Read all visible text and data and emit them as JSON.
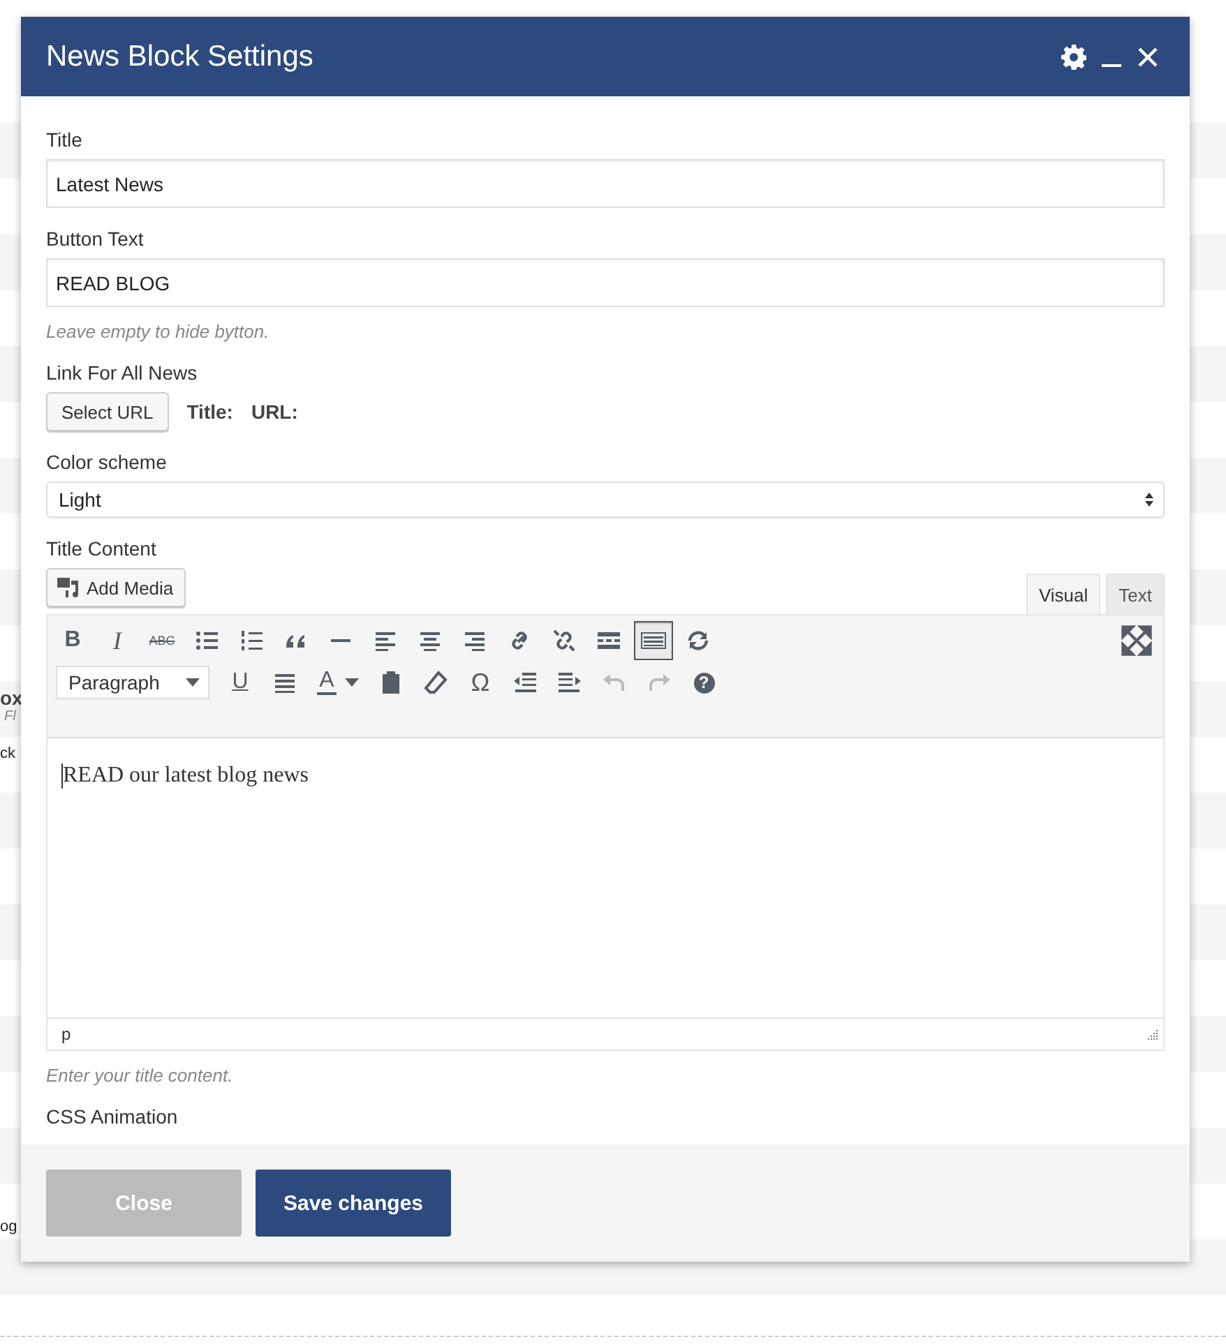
{
  "background_fragments": [
    {
      "text": "ox",
      "kind": "bold"
    },
    {
      "text": "Fl",
      "kind": "italic"
    },
    {
      "text": "ck",
      "kind": "plain"
    },
    {
      "text": "og",
      "kind": "plain"
    }
  ],
  "window": {
    "title": "News Block Settings"
  },
  "fields": [
    {
      "kind": "input",
      "label": "Title",
      "value": "Latest News"
    },
    {
      "kind": "input",
      "label": "Button Text",
      "value": "READ BLOG",
      "hint": "Leave empty to hide bytton."
    },
    {
      "kind": "link",
      "label": "Link For All News",
      "button": "Select URL",
      "title_label": "Title:",
      "url_label": "URL:"
    },
    {
      "kind": "select",
      "label": "Color scheme",
      "value": "Light"
    }
  ],
  "editor": {
    "label": "Title Content",
    "add_media": "Add Media",
    "tabs": [
      {
        "label": "Visual",
        "selected": true
      },
      {
        "label": "Text",
        "selected": false
      }
    ],
    "toolbar_row_1": [
      {
        "kind": "bold",
        "label": "B",
        "pressed": false,
        "disabled": false
      },
      {
        "kind": "italic",
        "label": "I",
        "pressed": false,
        "disabled": false
      },
      {
        "kind": "strike",
        "label": "ABC",
        "pressed": false,
        "disabled": false
      },
      {
        "kind": "bullets",
        "pressed": false,
        "disabled": false
      },
      {
        "kind": "numbers",
        "pressed": false,
        "disabled": false
      },
      {
        "kind": "quote",
        "pressed": false,
        "disabled": false
      },
      {
        "kind": "rule",
        "pressed": false,
        "disabled": false
      },
      {
        "kind": "align-left",
        "pressed": false,
        "disabled": false
      },
      {
        "kind": "align-center",
        "pressed": false,
        "disabled": false
      },
      {
        "kind": "align-right",
        "pressed": false,
        "disabled": false
      },
      {
        "kind": "link",
        "pressed": false,
        "disabled": false
      },
      {
        "kind": "unlink",
        "pressed": false,
        "disabled": false
      },
      {
        "kind": "more",
        "pressed": false,
        "disabled": false
      },
      {
        "kind": "keyboard",
        "pressed": true,
        "disabled": false
      },
      {
        "kind": "refresh",
        "pressed": false,
        "disabled": false
      }
    ],
    "toolbar_row_2": [
      {
        "kind": "format",
        "label": "Paragraph",
        "pressed": false,
        "disabled": false
      },
      {
        "kind": "underline",
        "label": "U",
        "pressed": false,
        "disabled": false
      },
      {
        "kind": "justify",
        "pressed": false,
        "disabled": false
      },
      {
        "kind": "color",
        "label": "A",
        "pressed": false,
        "disabled": false
      },
      {
        "kind": "paste",
        "pressed": false,
        "disabled": false
      },
      {
        "kind": "eraser",
        "pressed": false,
        "disabled": false
      },
      {
        "kind": "omega",
        "label": "Ω",
        "pressed": false,
        "disabled": false
      },
      {
        "kind": "outdent",
        "pressed": false,
        "disabled": false
      },
      {
        "kind": "indent",
        "pressed": false,
        "disabled": false
      },
      {
        "kind": "undo",
        "pressed": false,
        "disabled": true
      },
      {
        "kind": "redo",
        "pressed": false,
        "disabled": true
      },
      {
        "kind": "help",
        "label": "?",
        "pressed": false,
        "disabled": false
      }
    ],
    "content": "READ our latest blog news",
    "path": "p",
    "hint": "Enter your title content."
  },
  "next_label": "CSS Animation",
  "buttons": [
    {
      "label": "Close",
      "kind": "secondary"
    },
    {
      "label": "Save changes",
      "kind": "primary"
    }
  ]
}
